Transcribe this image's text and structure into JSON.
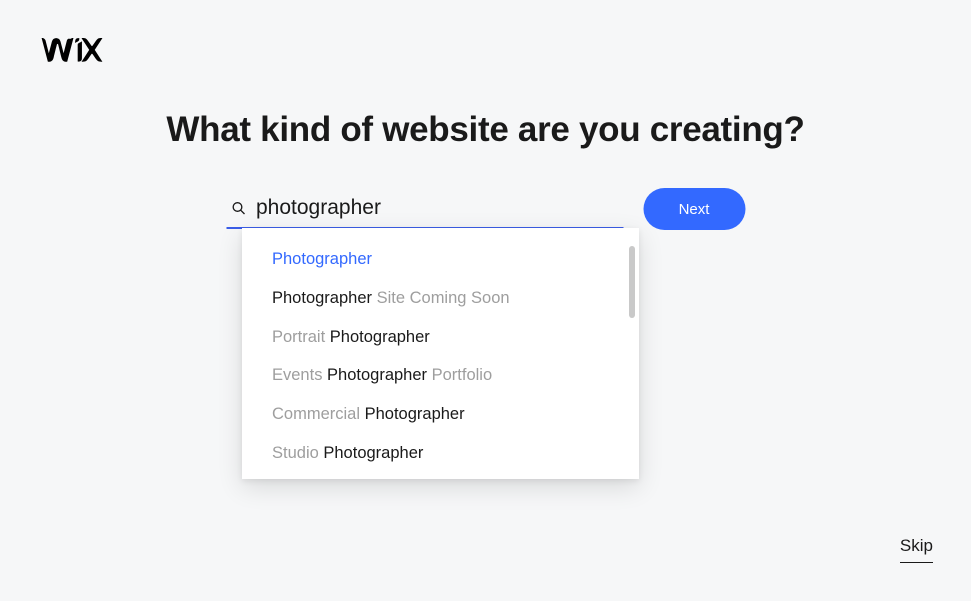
{
  "heading": "What kind of website are you creating?",
  "search": {
    "value": "photographer",
    "placeholder": ""
  },
  "next_label": "Next",
  "skip_label": "Skip",
  "suggestions": [
    {
      "segments": [
        {
          "text": "Photographer",
          "faded": false
        }
      ],
      "active": true
    },
    {
      "segments": [
        {
          "text": "Photographer",
          "faded": false
        },
        {
          "text": " Site Coming Soon",
          "faded": true
        }
      ],
      "active": false
    },
    {
      "segments": [
        {
          "text": "Portrait ",
          "faded": true
        },
        {
          "text": "Photographer",
          "faded": false
        }
      ],
      "active": false
    },
    {
      "segments": [
        {
          "text": "Events ",
          "faded": true
        },
        {
          "text": "Photographer",
          "faded": false
        },
        {
          "text": " Portfolio",
          "faded": true
        }
      ],
      "active": false
    },
    {
      "segments": [
        {
          "text": "Commercial ",
          "faded": true
        },
        {
          "text": "Photographer",
          "faded": false
        }
      ],
      "active": false
    },
    {
      "segments": [
        {
          "text": "Studio ",
          "faded": true
        },
        {
          "text": "Photographer",
          "faded": false
        }
      ],
      "active": false
    }
  ]
}
